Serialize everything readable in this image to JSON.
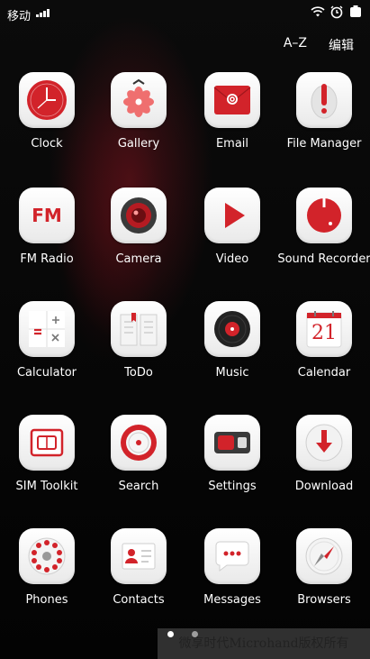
{
  "status": {
    "carrier": "移动"
  },
  "header": {
    "sort_label": "A–Z",
    "edit_label": "编辑"
  },
  "apps": [
    {
      "label": "Clock"
    },
    {
      "label": "Gallery"
    },
    {
      "label": "Email"
    },
    {
      "label": "File Manager"
    },
    {
      "label": "FM Radio"
    },
    {
      "label": "Camera"
    },
    {
      "label": "Video"
    },
    {
      "label": "Sound Recorder"
    },
    {
      "label": "Calculator"
    },
    {
      "label": "ToDo"
    },
    {
      "label": "Music"
    },
    {
      "label": "Calendar"
    },
    {
      "label": "SIM Toolkit"
    },
    {
      "label": "Search"
    },
    {
      "label": "Settings"
    },
    {
      "label": "Download"
    },
    {
      "label": "Phones"
    },
    {
      "label": "Contacts"
    },
    {
      "label": "Messages"
    },
    {
      "label": "Browsers"
    }
  ],
  "icon_text": {
    "fm": "FM",
    "calendar_day": "21"
  },
  "accent_color": "#d2232a",
  "page_indicator": {
    "current": 1,
    "total": 2
  },
  "watermark": "微享时代Microhand版权所有"
}
